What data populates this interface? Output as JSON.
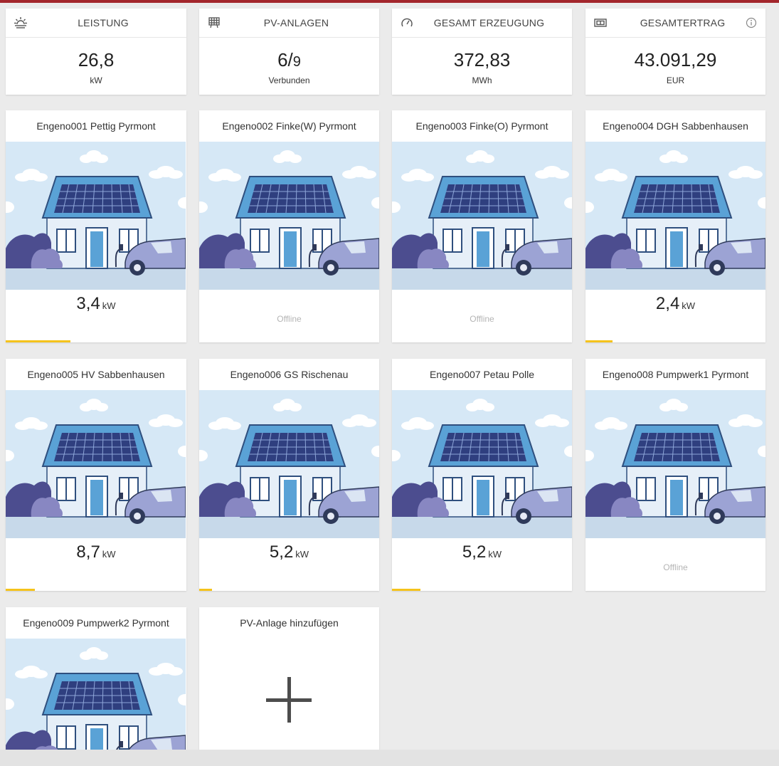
{
  "stats": [
    {
      "title": "LEISTUNG",
      "value": "26,8",
      "unit": "kW",
      "icon": "sun-icon"
    },
    {
      "title": "PV-ANLAGEN",
      "value": "6/",
      "value_small": "9",
      "unit": "Verbunden",
      "icon": "solar-panel-icon"
    },
    {
      "title": "GESAMT ERZEUGUNG",
      "value": "372,83",
      "unit": "MWh",
      "icon": "gauge-icon"
    },
    {
      "title": "GESAMTERTRAG",
      "value": "43.091,29",
      "unit": "EUR",
      "icon": "money-icon",
      "info_icon": "info-icon"
    }
  ],
  "plants": [
    {
      "name": "Engeno001 Pettig Pyrmont",
      "power": "3,4",
      "unit": "kW",
      "status": "",
      "progress_percent": 36
    },
    {
      "name": "Engeno002 Finke(W) Pyrmont",
      "power": "",
      "unit": "",
      "status": "Offline",
      "progress_percent": 0
    },
    {
      "name": "Engeno003 Finke(O) Pyrmont",
      "power": "",
      "unit": "",
      "status": "Offline",
      "progress_percent": 0
    },
    {
      "name": "Engeno004 DGH Sabbenhausen",
      "power": "2,4",
      "unit": "kW",
      "status": "",
      "progress_percent": 15
    },
    {
      "name": "Engeno005 HV Sabbenhausen",
      "power": "8,7",
      "unit": "kW",
      "status": "",
      "progress_percent": 16
    },
    {
      "name": "Engeno006 GS Rischenau",
      "power": "5,2",
      "unit": "kW",
      "status": "",
      "progress_percent": 7
    },
    {
      "name": "Engeno007 Petau Polle",
      "power": "5,2",
      "unit": "kW",
      "status": "",
      "progress_percent": 16
    },
    {
      "name": "Engeno008 Pumpwerk1 Pyrmont",
      "power": "",
      "unit": "",
      "status": "Offline",
      "progress_percent": 0
    },
    {
      "name": "Engeno009 Pumpwerk2 Pyrmont",
      "power": "",
      "unit": "",
      "status": "",
      "progress_percent": 0
    }
  ],
  "add_plant": {
    "label": "PV-Anlage hinzufügen",
    "icon": "plus-icon"
  },
  "colors": {
    "accent_bar": "#f5c31c",
    "top_line": "#a3262c",
    "background": "#ebebeb"
  }
}
